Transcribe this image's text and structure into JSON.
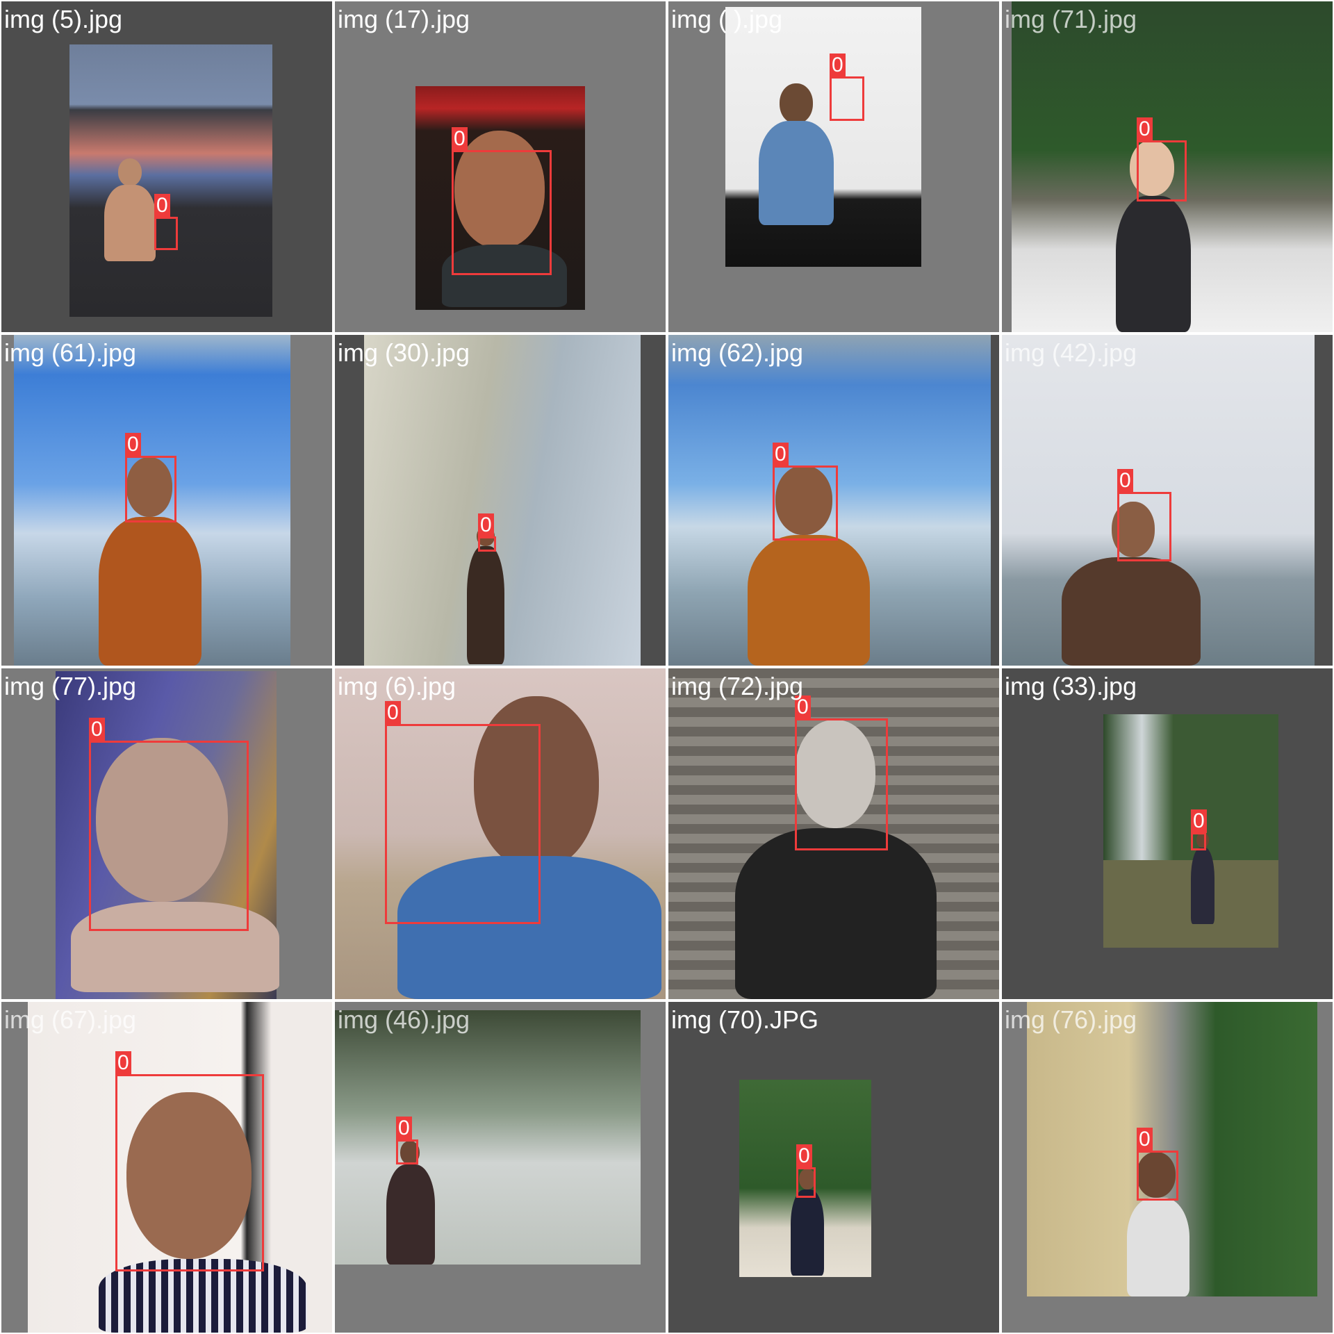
{
  "grid": {
    "tiles": [
      {
        "filename": "img (5).jpg",
        "detection_label": "0"
      },
      {
        "filename": "img (17).jpg",
        "detection_label": "0"
      },
      {
        "filename": "img (  ).jpg",
        "detection_label": "0"
      },
      {
        "filename": "img (71).jpg",
        "detection_label": "0"
      },
      {
        "filename": "img (61).jpg",
        "detection_label": "0"
      },
      {
        "filename": "img (30).jpg",
        "detection_label": "0"
      },
      {
        "filename": "img (62).jpg",
        "detection_label": "0"
      },
      {
        "filename": "img (42).jpg",
        "detection_label": "0"
      },
      {
        "filename": "img (77).jpg",
        "detection_label": "0"
      },
      {
        "filename": "img (6).jpg",
        "detection_label": "0"
      },
      {
        "filename": "img (72).jpg",
        "detection_label": "0"
      },
      {
        "filename": "img (33).jpg",
        "detection_label": "0"
      },
      {
        "filename": "img (67).jpg",
        "detection_label": "0"
      },
      {
        "filename": "img (46).jpg",
        "detection_label": "0"
      },
      {
        "filename": "img (70).JPG",
        "detection_label": "0"
      },
      {
        "filename": "img (76).jpg",
        "detection_label": "0"
      }
    ]
  },
  "colors": {
    "bbox": "#ee3b3b",
    "tile_background_dark": "#4d4d4d",
    "tile_background_mid": "#7b7b7b",
    "label_text": "#ffffff"
  }
}
